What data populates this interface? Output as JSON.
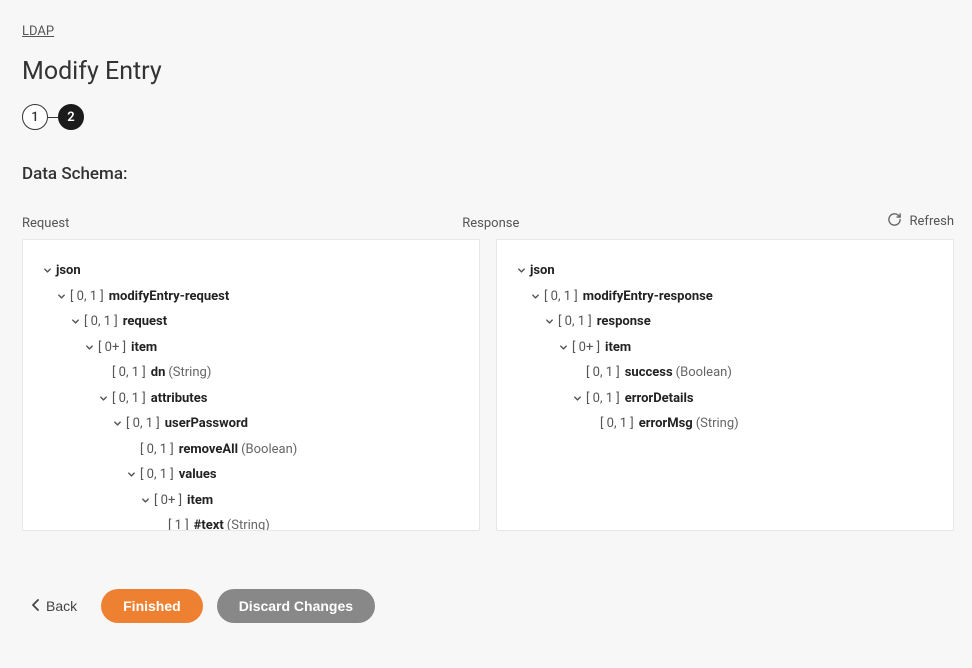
{
  "breadcrumb": "LDAP",
  "title": "Modify Entry",
  "stepper": {
    "step1": "1",
    "step2": "2"
  },
  "section_label": "Data Schema:",
  "refresh_label": "Refresh",
  "panels": {
    "request_header": "Request",
    "response_header": "Response"
  },
  "request_tree": [
    {
      "indent": 0,
      "chevron": true,
      "card": "",
      "name": "json",
      "type": ""
    },
    {
      "indent": 1,
      "chevron": true,
      "card": "[ 0, 1 ]",
      "name": "modifyEntry-request",
      "type": ""
    },
    {
      "indent": 2,
      "chevron": true,
      "card": "[ 0, 1 ]",
      "name": "request",
      "type": ""
    },
    {
      "indent": 3,
      "chevron": true,
      "card": "[ 0+ ]",
      "name": "item",
      "type": ""
    },
    {
      "indent": 4,
      "chevron": false,
      "card": "[ 0, 1 ]",
      "name": "dn",
      "type": "(String)"
    },
    {
      "indent": 4,
      "chevron": true,
      "card": "[ 0, 1 ]",
      "name": "attributes",
      "type": ""
    },
    {
      "indent": 5,
      "chevron": true,
      "card": "[ 0, 1 ]",
      "name": "userPassword",
      "type": ""
    },
    {
      "indent": 6,
      "chevron": false,
      "card": "[ 0, 1 ]",
      "name": "removeAll",
      "type": "(Boolean)"
    },
    {
      "indent": 6,
      "chevron": true,
      "card": "[ 0, 1 ]",
      "name": "values",
      "type": ""
    },
    {
      "indent": 7,
      "chevron": true,
      "card": "[ 0+ ]",
      "name": "item",
      "type": ""
    },
    {
      "indent": 8,
      "chevron": false,
      "card": "[ 1 ]",
      "name": "#text",
      "type": "(String)"
    }
  ],
  "response_tree": [
    {
      "indent": 0,
      "chevron": true,
      "card": "",
      "name": "json",
      "type": ""
    },
    {
      "indent": 1,
      "chevron": true,
      "card": "[ 0, 1 ]",
      "name": "modifyEntry-response",
      "type": ""
    },
    {
      "indent": 2,
      "chevron": true,
      "card": "[ 0, 1 ]",
      "name": "response",
      "type": ""
    },
    {
      "indent": 3,
      "chevron": true,
      "card": "[ 0+ ]",
      "name": "item",
      "type": ""
    },
    {
      "indent": 4,
      "chevron": false,
      "card": "[ 0, 1 ]",
      "name": "success",
      "type": "(Boolean)"
    },
    {
      "indent": 4,
      "chevron": true,
      "card": "[ 0, 1 ]",
      "name": "errorDetails",
      "type": ""
    },
    {
      "indent": 5,
      "chevron": false,
      "card": "[ 0, 1 ]",
      "name": "errorMsg",
      "type": "(String)"
    }
  ],
  "footer": {
    "back": "Back",
    "finished": "Finished",
    "discard": "Discard Changes"
  }
}
